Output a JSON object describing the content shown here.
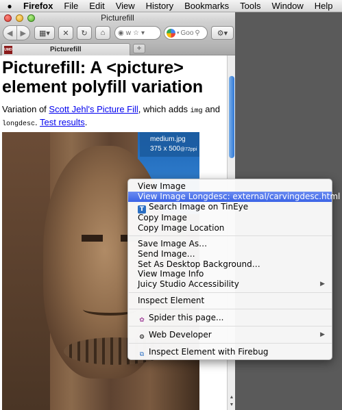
{
  "menubar": {
    "apple": "",
    "items": [
      "Firefox",
      "File",
      "Edit",
      "View",
      "History",
      "Bookmarks",
      "Tools",
      "Window",
      "Help"
    ]
  },
  "window": {
    "title": "Picturefill",
    "url_text": "w",
    "search_text": "Goo",
    "tab_label": "Picturefill",
    "new_tab": "+"
  },
  "page": {
    "heading": "Picturefill: A <picture> element polyfill variation",
    "intro": {
      "text1": "Variation of ",
      "link1": "Scott Jehl's Picture Fill",
      "text2": ", which adds ",
      "code1": "img",
      "text3": " and ",
      "code2": "longdesc",
      "text4": ". ",
      "link2": "Test results",
      "text5": "."
    },
    "image_caption": {
      "filename": "medium.jpg",
      "dims": "375 x 500",
      "ppi": "@72ppi"
    }
  },
  "context_menu": {
    "items": [
      {
        "label": "View Image"
      },
      {
        "label": "View Image Longdesc: external/carvingdesc.html",
        "highlighted": true
      },
      {
        "label": "Search Image on TinEye",
        "icon": "tineye-icon"
      },
      {
        "label": "Copy Image"
      },
      {
        "label": "Copy Image Location"
      },
      {
        "label": "Save Image As…"
      },
      {
        "label": "Send Image…"
      },
      {
        "label": "Set As Desktop Background…"
      },
      {
        "label": "View Image Info"
      },
      {
        "label": "Juicy Studio Accessibility",
        "submenu": true
      },
      {
        "label": "Inspect Element"
      },
      {
        "label": "Spider this page...",
        "icon": "spider-icon"
      },
      {
        "label": "Web Developer",
        "icon": "gear-icon",
        "submenu": true
      },
      {
        "label": "Inspect Element with Firebug",
        "icon": "firebug-icon"
      }
    ]
  }
}
